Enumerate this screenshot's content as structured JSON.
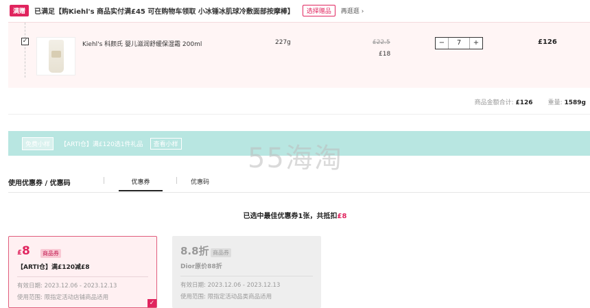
{
  "promo": {
    "tag": "满赠",
    "text": "已满足【购Kiehl's 商品实付满£45 可在购物车领取 小冰锤冰肌球冷敷面部按摩棒】",
    "select_label": "选择赠品",
    "more_label": "再逛逛 ›"
  },
  "item": {
    "checkbox_mark": "✓",
    "name": "Kiehl's 科颜氏 婴儿滋润舒缓保湿霜 200ml",
    "weight": "227g",
    "price_original": "£22.5",
    "price_now": "£18",
    "qty_minus": "−",
    "qty_value": "7",
    "qty_plus": "+",
    "total": "£126"
  },
  "summary": {
    "amount_label": "商品金额合计:",
    "amount_value": "£126",
    "weight_label": "重量:",
    "weight_value": "1589g"
  },
  "sample": {
    "tag": "免费小样",
    "text": "【ARTI仓】满£120选1件礼品",
    "button": "查看小样"
  },
  "watermark": "55海淘",
  "coupons": {
    "title": "使用优惠券 / 优惠码",
    "tab_coupon": "优惠券",
    "tab_code": "优惠码",
    "selected_prefix": "已选中最佳优惠券1张，共抵扣",
    "selected_amount": "£8",
    "cards": [
      {
        "amount_currency": "£",
        "amount_value": "8",
        "kind": "商品券",
        "desc": "【ARTI仓】满£120减£8",
        "valid": "有效日期: 2023.12.06 - 2023.12.13",
        "scope": "使用范围: 限指定活动店铺商品适用",
        "check": "✓"
      },
      {
        "amount_text": "8.8折",
        "kind": "商品券",
        "desc": "Dior原价88折",
        "valid": "有效日期: 2023.12.06 - 2023.12.13",
        "scope": "使用范围: 限指定活动品类商品适用"
      }
    ]
  },
  "colors": {
    "accent": "#e0245e",
    "sample_bg": "#b8e6e1",
    "item_bg": "#fff5f5"
  }
}
